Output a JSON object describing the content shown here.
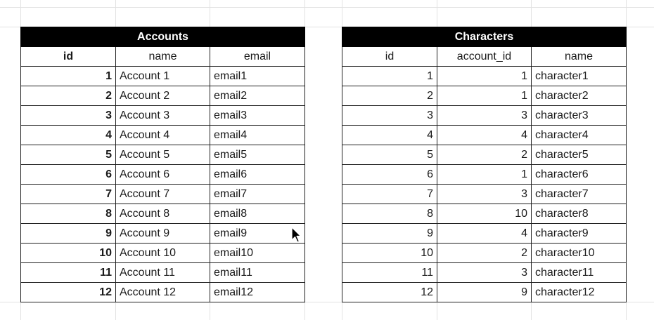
{
  "accounts": {
    "title": "Accounts",
    "headers": [
      "id",
      "name",
      "email"
    ],
    "rows": [
      [
        "1",
        "Account 1",
        "email1"
      ],
      [
        "2",
        "Account 2",
        "email2"
      ],
      [
        "3",
        "Account 3",
        "email3"
      ],
      [
        "4",
        "Account 4",
        "email4"
      ],
      [
        "5",
        "Account 5",
        "email5"
      ],
      [
        "6",
        "Account 6",
        "email6"
      ],
      [
        "7",
        "Account 7",
        "email7"
      ],
      [
        "8",
        "Account 8",
        "email8"
      ],
      [
        "9",
        "Account 9",
        "email9"
      ],
      [
        "10",
        "Account 10",
        "email10"
      ],
      [
        "11",
        "Account 11",
        "email11"
      ],
      [
        "12",
        "Account 12",
        "email12"
      ]
    ]
  },
  "characters": {
    "title": "Characters",
    "headers": [
      "id",
      "account_id",
      "name"
    ],
    "rows": [
      [
        "1",
        "1",
        "character1"
      ],
      [
        "2",
        "1",
        "character2"
      ],
      [
        "3",
        "3",
        "character3"
      ],
      [
        "4",
        "4",
        "character4"
      ],
      [
        "5",
        "2",
        "character5"
      ],
      [
        "6",
        "1",
        "character6"
      ],
      [
        "7",
        "3",
        "character7"
      ],
      [
        "8",
        "10",
        "character8"
      ],
      [
        "9",
        "4",
        "character9"
      ],
      [
        "10",
        "2",
        "character10"
      ],
      [
        "11",
        "3",
        "character11"
      ],
      [
        "12",
        "9",
        "character12"
      ]
    ]
  },
  "cursor_icon": "mouse-pointer-icon"
}
